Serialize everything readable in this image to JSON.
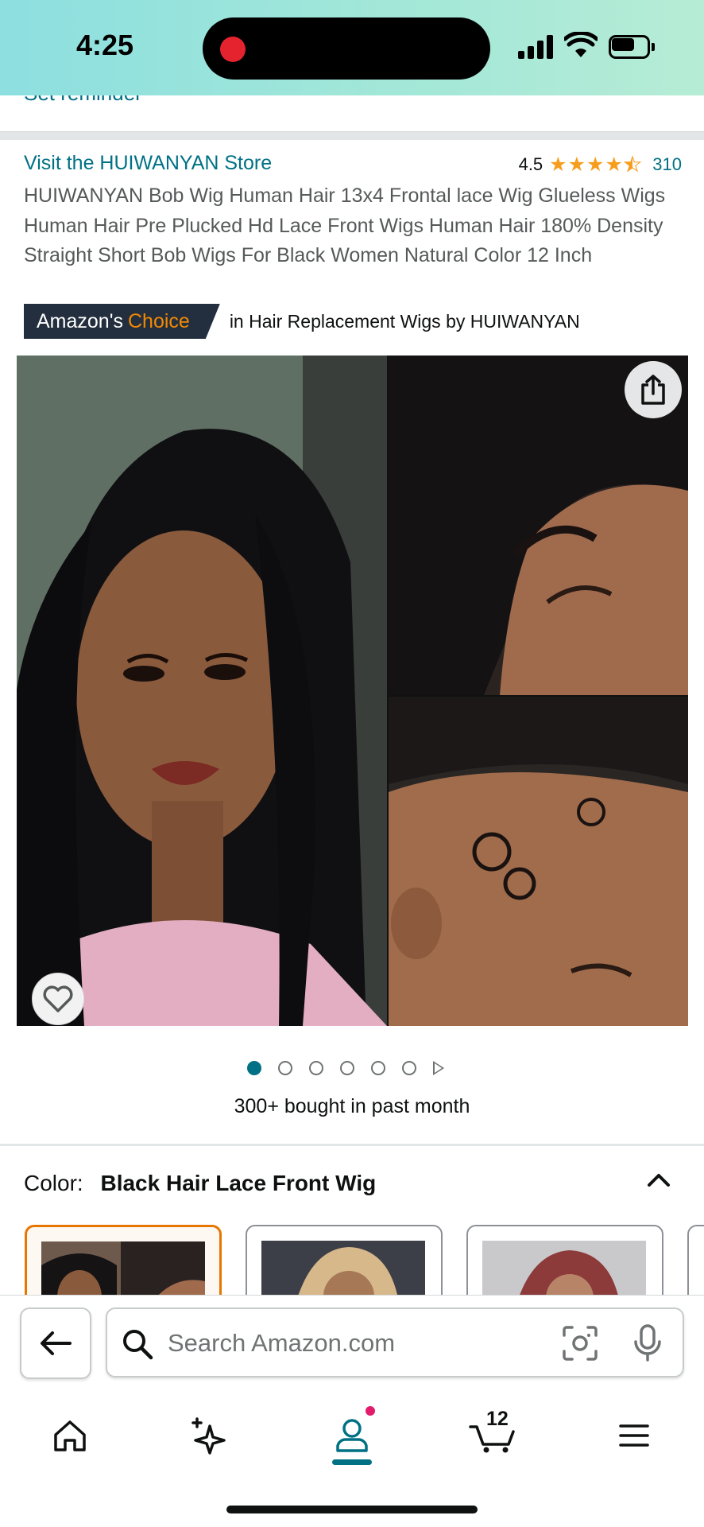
{
  "status_bar": {
    "time": "4:25"
  },
  "partial_text": "Set reminder",
  "product": {
    "store_link": "Visit the HUIWANYAN Store",
    "rating": "4.5",
    "review_count": "310",
    "title": "HUIWANYAN Bob Wig Human Hair 13x4 Frontal lace Wig Glueless Wigs Human Hair Pre Plucked Hd Lace Front Wigs Human Hair 180% Density Straight Short Bob Wigs For Black Women Natural Color 12 Inch",
    "badge_prefix": "Amazon's",
    "badge_suffix": "Choice",
    "badge_category": "in Hair Replacement Wigs by HUIWANYAN",
    "bought_text": "300+ bought in past month"
  },
  "carousel": {
    "image_count": 6,
    "active_index": 0
  },
  "color": {
    "label": "Color:",
    "value": "Black Hair Lace Front Wig"
  },
  "search": {
    "placeholder": "Search Amazon.com"
  },
  "cart": {
    "count": "12"
  },
  "icons": {
    "share": "share-icon",
    "heart": "heart-icon",
    "back": "back-arrow-icon",
    "search": "search-icon",
    "camera": "camera-icon",
    "mic": "mic-icon",
    "home": "home-icon",
    "sparkle": "sparkle-icon",
    "profile": "profile-icon",
    "cart": "cart-icon",
    "menu": "menu-icon"
  },
  "colors": {
    "link": "#007185",
    "badge_bg": "#232f3e",
    "badge_accent": "#f08804",
    "star": "#f79d1e",
    "selected_swatch": "#e77600",
    "notification": "#e31b6d"
  }
}
